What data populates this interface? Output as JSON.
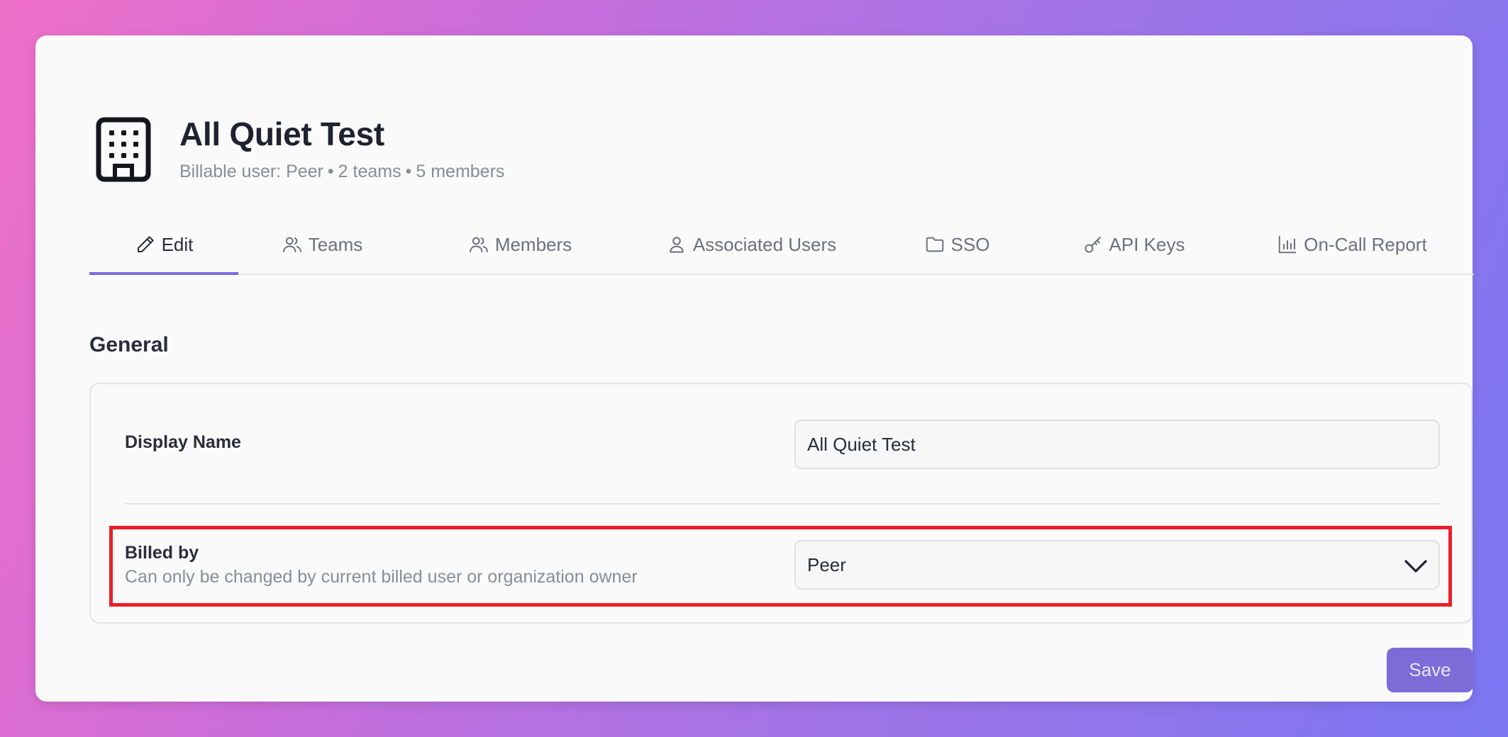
{
  "organization": {
    "name": "All Quiet Test",
    "billable_user": "Billable user: Peer",
    "teams": "2 teams",
    "members": "5 members",
    "separator": "•",
    "icon": "building-icon"
  },
  "tabs": [
    {
      "label": "Edit",
      "icon": "pencil-icon",
      "active": true
    },
    {
      "label": "Teams",
      "icon": "users-icon",
      "active": false
    },
    {
      "label": "Members",
      "icon": "users-icon",
      "active": false
    },
    {
      "label": "Associated Users",
      "icon": "user-icon",
      "active": false
    },
    {
      "label": "SSO",
      "icon": "folder-icon",
      "active": false
    },
    {
      "label": "API Keys",
      "icon": "key-icon",
      "active": false
    },
    {
      "label": "On-Call Report",
      "icon": "bar-chart-icon",
      "active": false
    }
  ],
  "section": {
    "title": "General"
  },
  "form": {
    "display_name": {
      "label": "Display Name",
      "value": "All Quiet Test"
    },
    "billed_by": {
      "label": "Billed by",
      "help": "Can only be changed by current billed user or organization owner",
      "value": "Peer"
    }
  },
  "actions": {
    "save_label": "Save"
  },
  "colors": {
    "accent": "#7d6bd8",
    "highlight": "#e8202a"
  }
}
